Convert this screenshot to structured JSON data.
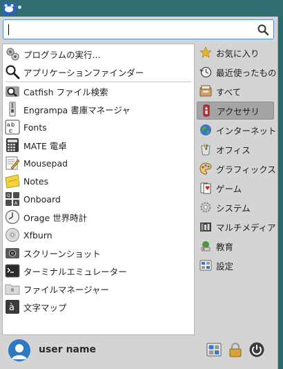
{
  "panel": {
    "launcher_icon": "xfce-mouse-icon"
  },
  "search": {
    "value": "",
    "placeholder": "",
    "icon": "search-icon"
  },
  "apps": [
    {
      "label": "プログラムの実行...",
      "icon": "run-program-icon"
    },
    {
      "label": "アプリケーションファインダー",
      "icon": "app-finder-icon"
    },
    {
      "label": "Catfish ファイル検索",
      "icon": "catfish-icon"
    },
    {
      "label": "Engrampa 書庫マネージャ",
      "icon": "archive-manager-icon"
    },
    {
      "label": "Fonts",
      "icon": "fonts-icon"
    },
    {
      "label": "MATE 電卓",
      "icon": "calculator-icon"
    },
    {
      "label": "Mousepad",
      "icon": "text-editor-icon"
    },
    {
      "label": "Notes",
      "icon": "notes-icon"
    },
    {
      "label": "Onboard",
      "icon": "onboard-keyboard-icon"
    },
    {
      "label": "Orage 世界時計",
      "icon": "clock-icon"
    },
    {
      "label": "Xfburn",
      "icon": "disc-burner-icon"
    },
    {
      "label": "スクリーンショット",
      "icon": "screenshot-icon"
    },
    {
      "label": "ターミナルエミュレーター",
      "icon": "terminal-icon"
    },
    {
      "label": "ファイルマネージャー",
      "icon": "file-manager-icon"
    },
    {
      "label": "文字マップ",
      "icon": "character-map-icon"
    }
  ],
  "categories": [
    {
      "label": "お気に入り",
      "icon": "star-icon"
    },
    {
      "label": "最近使ったもの",
      "icon": "recent-icon"
    },
    {
      "label": "すべて",
      "icon": "all-apps-icon"
    },
    {
      "label": "アクセサリ",
      "icon": "accessories-icon",
      "active": true
    },
    {
      "label": "インターネット",
      "icon": "globe-icon"
    },
    {
      "label": "オフィス",
      "icon": "office-icon"
    },
    {
      "label": "グラフィックス",
      "icon": "graphics-icon"
    },
    {
      "label": "ゲーム",
      "icon": "games-icon"
    },
    {
      "label": "システム",
      "icon": "system-gear-icon"
    },
    {
      "label": "マルチメディア",
      "icon": "multimedia-icon"
    },
    {
      "label": "教育",
      "icon": "education-icon"
    },
    {
      "label": "設定",
      "icon": "settings-icon"
    }
  ],
  "user": {
    "name": "user name"
  },
  "bottom_actions": {
    "settings_icon": "settings-manager-icon",
    "lock_icon": "lock-icon",
    "power_icon": "power-icon"
  },
  "colors": {
    "accent": "#4a8fd6",
    "panel_bg": "#2f6d73",
    "menu_bg": "#d4d4d4"
  }
}
